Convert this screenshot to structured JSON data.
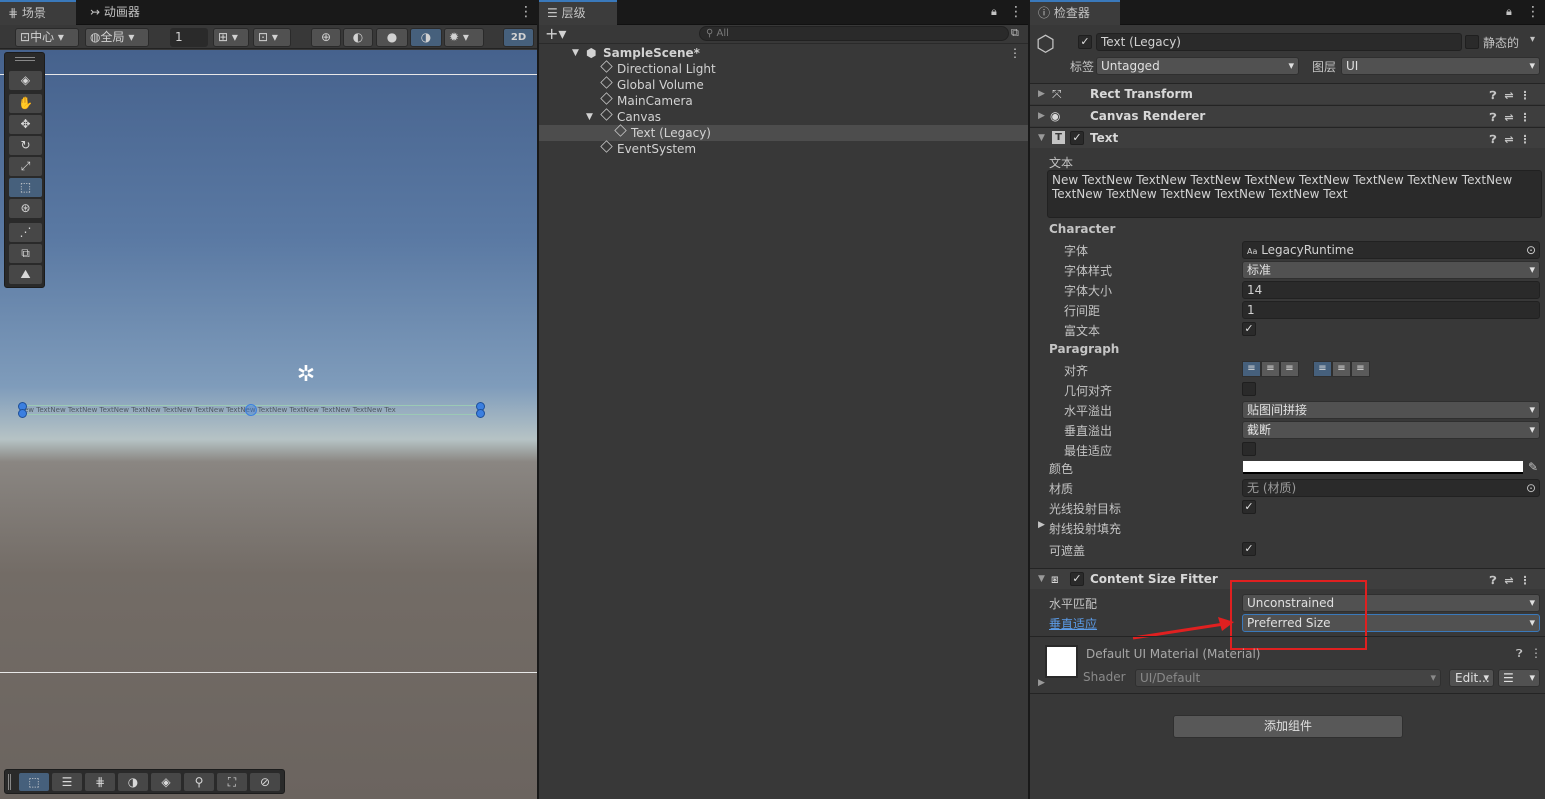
{
  "scene": {
    "tab_label": "场景",
    "tab2_label": "动画器",
    "pivot": "中心",
    "space": "全局",
    "grid_value": "1",
    "mode_2d": "2D",
    "text_preview": "ew TextNew TextNew TextNew TextNew TextNew TextNew TextNew TextNew TextNew TextNew TextNew Tex"
  },
  "hierarchy": {
    "tab_label": "层级",
    "search_placeholder": "All",
    "items": [
      {
        "label": "SampleScene*"
      },
      {
        "label": "Directional Light"
      },
      {
        "label": "Global Volume"
      },
      {
        "label": "MainCamera"
      },
      {
        "label": "Canvas"
      },
      {
        "label": "Text (Legacy)"
      },
      {
        "label": "EventSystem"
      }
    ]
  },
  "inspector": {
    "tab_label": "检查器",
    "object_name": "Text (Legacy)",
    "static_label": "静态的",
    "tag_label": "标签",
    "tag_value": "Untagged",
    "layer_label": "图层",
    "layer_value": "UI",
    "components": {
      "rect_transform": "Rect Transform",
      "canvas_renderer": "Canvas Renderer",
      "text": "Text",
      "content_size_fitter": "Content Size Fitter"
    },
    "text_section": {
      "text_label": "文本",
      "text_value": "New TextNew TextNew TextNew TextNew TextNew TextNew TextNew TextNew TextNew TextNew TextNew TextNew TextNew Text",
      "character_header": "Character",
      "font_label": "字体",
      "font_value": "LegacyRuntime",
      "font_style_label": "字体样式",
      "font_style_value": "标准",
      "font_size_label": "字体大小",
      "font_size_value": "14",
      "line_spacing_label": "行间距",
      "line_spacing_value": "1",
      "rich_text_label": "富文本",
      "paragraph_header": "Paragraph",
      "alignment_label": "对齐",
      "align_geometry_label": "几何对齐",
      "horizontal_overflow_label": "水平溢出",
      "horizontal_overflow_value": "贴图间拼接",
      "vertical_overflow_label": "垂直溢出",
      "vertical_overflow_value": "截断",
      "best_fit_label": "最佳适应",
      "color_label": "颜色",
      "material_label": "材质",
      "material_value": "无 (材质)",
      "raycast_target_label": "光线投射目标",
      "raycast_padding_label": "射线投射填充",
      "maskable_label": "可遮盖"
    },
    "fitter": {
      "horizontal_label": "水平匹配",
      "horizontal_value": "Unconstrained",
      "vertical_label": "垂直适应",
      "vertical_value": "Preferred Size"
    },
    "material": {
      "name": "Default UI Material (Material)",
      "shader_label": "Shader",
      "shader_value": "UI/Default",
      "edit_label": "Edit..."
    },
    "add_component_label": "添加组件"
  },
  "colors": {
    "accent": "#3a79bb",
    "highlight_box": "#e02020"
  }
}
